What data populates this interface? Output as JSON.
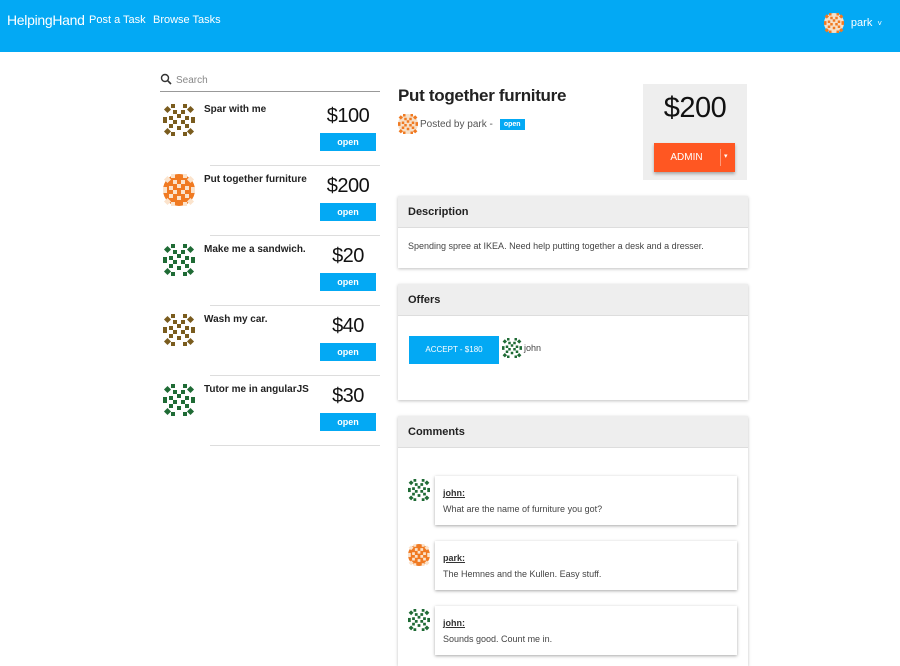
{
  "nav": {
    "brand": "HelpingHand",
    "links": [
      "Post a Task",
      "Browse Tasks"
    ],
    "user": "park",
    "user_caret": "˅"
  },
  "search": {
    "placeholder": "Search"
  },
  "tasks": [
    {
      "title": "Spar with me",
      "price": "$100",
      "status": "open",
      "avatar": "brown"
    },
    {
      "title": "Put together furniture",
      "price": "$200",
      "status": "open",
      "avatar": "orange"
    },
    {
      "title": "Make me a sandwich.",
      "price": "$20",
      "status": "open",
      "avatar": "green"
    },
    {
      "title": "Wash my car.",
      "price": "$40",
      "status": "open",
      "avatar": "brown"
    },
    {
      "title": "Tutor me in angularJS",
      "price": "$30",
      "status": "open",
      "avatar": "green"
    }
  ],
  "detail": {
    "title": "Put together furniture",
    "posted_by": "Posted by park -",
    "status": "open",
    "price": "$200",
    "admin_label": "ADMIN",
    "admin_caret": "▾"
  },
  "description": {
    "heading": "Description",
    "text": "Spending spree at IKEA. Need help putting together a desk and a dresser."
  },
  "offers": {
    "heading": "Offers",
    "accept_label": "ACCEPT - $180",
    "user": "john"
  },
  "comments": {
    "heading": "Comments",
    "items": [
      {
        "author": "john:",
        "text": "What are the name of furniture you got?"
      },
      {
        "author": "park:",
        "text": "The Hemnes and the Kullen. Easy stuff."
      },
      {
        "author": "john:",
        "text": "Sounds good. Count me in."
      }
    ]
  },
  "colors": {
    "primary": "#03a9f4",
    "accent": "#ff5722",
    "avatar_brown": "#7a5c1e",
    "avatar_orange": "#f07a22",
    "avatar_green": "#1f6b35"
  },
  "icons": {
    "search": "search-icon",
    "caret": "chevron-down-icon"
  }
}
